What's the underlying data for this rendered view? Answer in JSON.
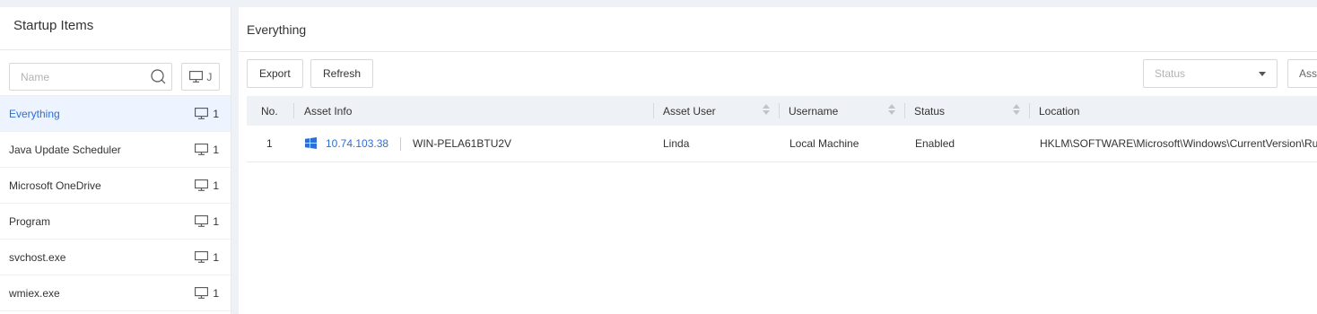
{
  "left_panel": {
    "title": "Startup Items",
    "search_placeholder": "Name",
    "view_button_label": " J",
    "items": [
      {
        "label": "Everything",
        "count": "1",
        "active": true
      },
      {
        "label": "Java Update Scheduler",
        "count": "1"
      },
      {
        "label": "Microsoft OneDrive",
        "count": "1"
      },
      {
        "label": "Program",
        "count": "1"
      },
      {
        "label": "svchost.exe",
        "count": "1"
      },
      {
        "label": "wmiex.exe",
        "count": "1"
      }
    ]
  },
  "main": {
    "title": "Everything",
    "toolbar": {
      "export_label": "Export",
      "refresh_label": "Refresh",
      "status_placeholder": "Status",
      "asset_label": "Ass"
    },
    "table": {
      "columns": [
        "No.",
        "Asset Info",
        "Asset User",
        "Username",
        "Status",
        "Location"
      ],
      "rows": [
        {
          "no": "1",
          "ip": "10.74.103.38",
          "hostname": "WIN-PELA61BTU2V",
          "asset_user": "Linda",
          "username": "Local Machine",
          "status": "Enabled",
          "location": "HKLM\\SOFTWARE\\Microsoft\\Windows\\CurrentVersion\\Run"
        }
      ]
    }
  },
  "colors": {
    "accent": "#2d6fd8",
    "active_bg": "#eef4ff",
    "header_bg": "#eef1f5"
  },
  "icons": [
    "search-icon",
    "monitor-icon",
    "windows-icon",
    "caret-down-icon",
    "sort-icon"
  ]
}
